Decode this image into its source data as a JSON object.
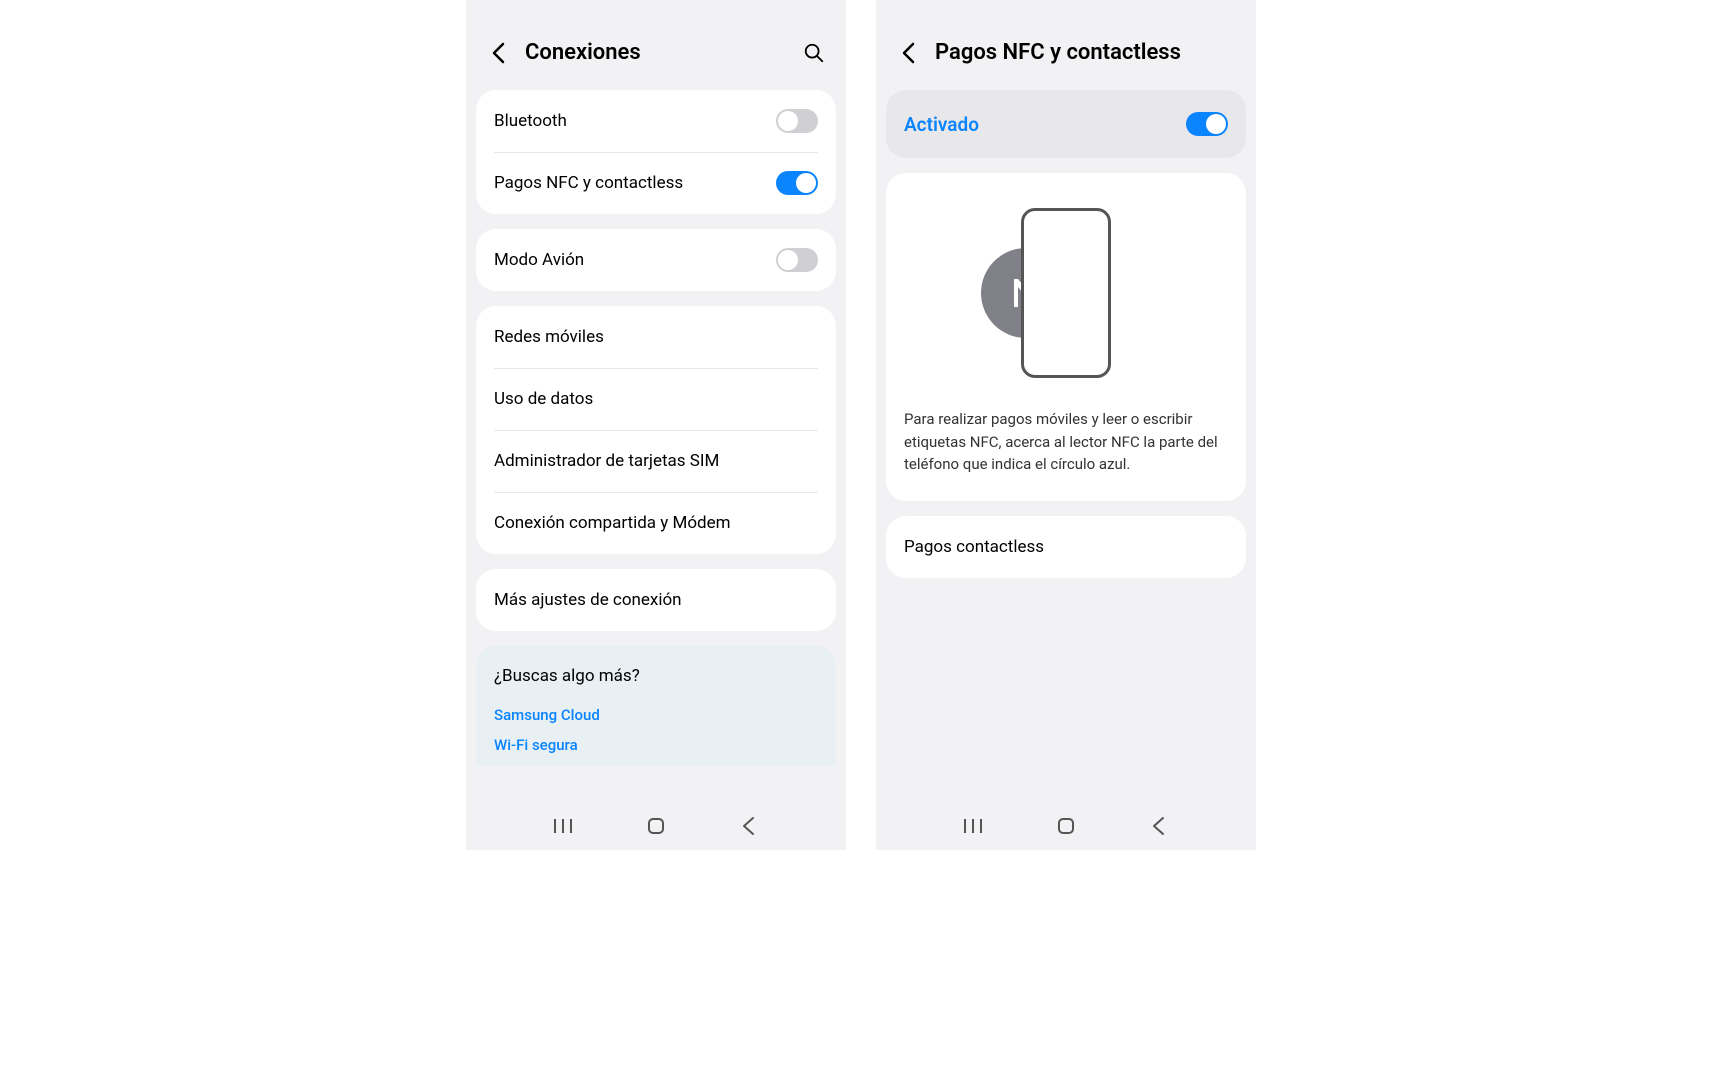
{
  "left": {
    "title": "Conexiones",
    "group1": [
      {
        "label": "Bluetooth",
        "toggle": "off"
      },
      {
        "label": "Pagos NFC y contactless",
        "toggle": "on"
      }
    ],
    "group2": [
      {
        "label": "Modo Avión",
        "toggle": "off"
      }
    ],
    "group3": [
      {
        "label": "Redes móviles"
      },
      {
        "label": "Uso de datos"
      },
      {
        "label": "Administrador de tarjetas SIM"
      },
      {
        "label": "Conexión compartida y Módem"
      }
    ],
    "group4": [
      {
        "label": "Más ajustes de conexión"
      }
    ],
    "search_more": {
      "title": "¿Buscas algo más?",
      "links": [
        "Samsung Cloud",
        "Wi-Fi segura"
      ]
    }
  },
  "right": {
    "title": "Pagos NFC y contactless",
    "active_label": "Activado",
    "active_toggle": "on",
    "description": "Para realizar pagos móviles y leer o escribir etiquetas NFC, acerca al lector NFC la parte del teléfono que indica el círculo azul.",
    "contactless_label": "Pagos contactless"
  }
}
